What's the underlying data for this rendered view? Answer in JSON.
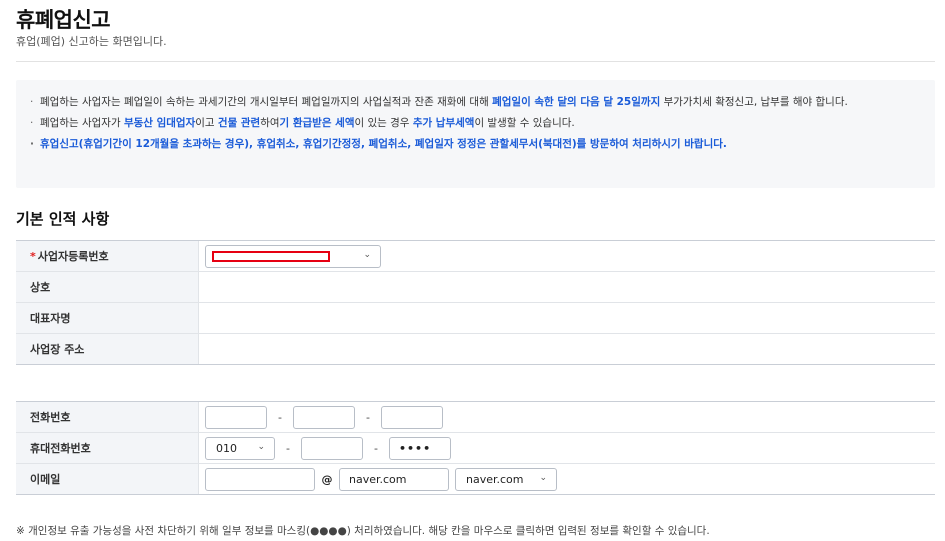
{
  "header": {
    "title": "휴폐업신고",
    "subtitle": "휴업(폐업) 신고하는 화면입니다."
  },
  "notice": {
    "item1": {
      "part1": "폐업하는 사업자는 폐업일이 속하는 과세기간의 개시일부터 폐업일까지의 사업실적과 잔존 재화에 대해 ",
      "highlight": "폐업일이 속한 달의 다음 달 25일까지",
      "part2": " 부가가치세 확정신고, 납부를 해야 합니다."
    },
    "item2": {
      "part1": "폐업하는 사업자가 ",
      "hl1": "부동산 임대업자",
      "part2": "이고 ",
      "hl2": "건물 관련",
      "part3": "하여",
      "hl3": "기 환급받은 세액",
      "part4": "이 있는 경우 ",
      "hl4": "추가 납부세액",
      "part5": "이 발생할 수 있습니다."
    },
    "item3": "휴업신고(휴업기간이 12개월을 초과하는 경우), 휴업취소, 휴업기간정정, 폐업취소, 폐업일자 정정은 관할세무서(북대전)를 방문하여 처리하시기 바랍니다."
  },
  "section": {
    "title": "기본 인적 사항"
  },
  "form": {
    "required_mark": "*",
    "business_number": {
      "label": "사업자등록번호",
      "value": ""
    },
    "company_name": {
      "label": "상호",
      "value": ""
    },
    "representative": {
      "label": "대표자명",
      "value": ""
    },
    "address": {
      "label": "사업장 주소",
      "value": ""
    },
    "phone": {
      "label": "전화번호",
      "part1": "",
      "part2": "",
      "part3": "",
      "separator": "-"
    },
    "mobile": {
      "label": "휴대전화번호",
      "prefix": "010",
      "part2": "",
      "part3": "••••",
      "separator": "-"
    },
    "email": {
      "label": "이메일",
      "local": "",
      "at": "@",
      "domain": "naver.com",
      "domain_select": "naver.com"
    }
  },
  "footnote": "※ 개인정보 유출 가능성을 사전 차단하기 위해 일부 정보를 마스킹(●●●●) 처리하였습니다. 해당 칸을 마우스로 클릭하면 입력된 정보를 확인할 수 있습니다.",
  "icons": {
    "dropdown": "chevron-down-icon"
  },
  "colors": {
    "accent": "#1a5bd8",
    "required": "#e02020",
    "mask": "#e60012"
  }
}
